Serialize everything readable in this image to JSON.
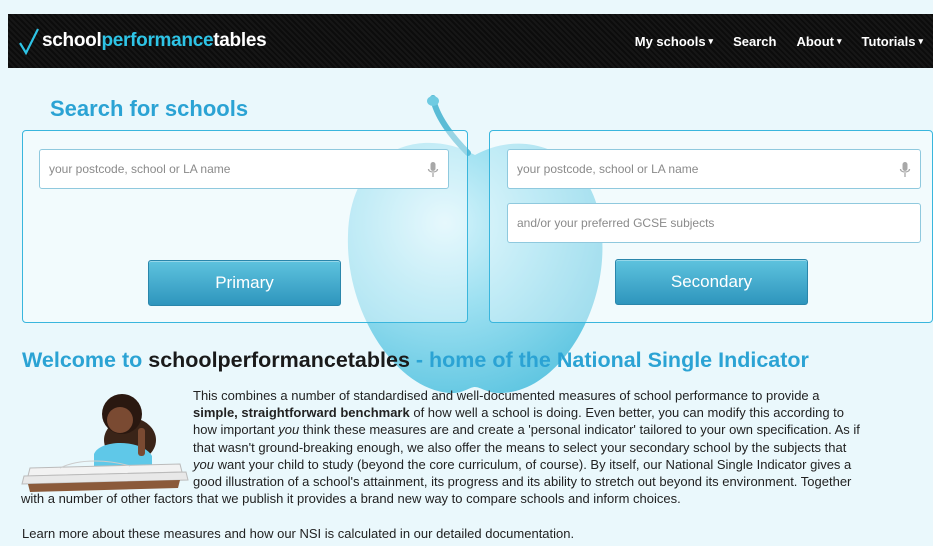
{
  "header": {
    "logo": {
      "prefix": "school",
      "middle": "performance",
      "suffix": "tables"
    },
    "nav": [
      {
        "label": "My schools",
        "dropdown": "▾"
      },
      {
        "label": "Search"
      },
      {
        "label": "About",
        "dropdown": "▾"
      },
      {
        "label": "Tutorials",
        "dropdown": "▾"
      }
    ]
  },
  "search": {
    "title": "Search for schools",
    "primary": {
      "placeholder": "your postcode, school or LA name",
      "button": "Primary"
    },
    "secondary": {
      "placeholder": "your postcode, school or LA name",
      "subjects_placeholder": "and/or your preferred GCSE subjects",
      "button": "Secondary"
    }
  },
  "welcome": {
    "heading_start": "Welcome to ",
    "heading_brand": "schoolperformancetables",
    "heading_end": " - home of the National Single Indicator",
    "p1_a": "This combines a number of standardised and well-documented measures of school performance to provide a",
    "p2_bold": "simple, straightforward benchmark",
    "p2_rest": " of how well a school is doing. Even better, you can modify this according to",
    "p3_a": "how important ",
    "p3_em": "you",
    "p3_b": " think these measures are and create a 'personal indicator' tailored to your own specification. As if",
    "p4": "that wasn't ground-breaking enough, we also offer the means to select your secondary school by the subjects that",
    "p5_em": "you",
    "p5_b": " want your child to study (beyond the core curriculum, of course). By itself, our National Single Indicator gives a",
    "p6": "good illustration of a school's attainment, its progress and its ability to stretch out beyond its environment. Together",
    "p7": "with a number of other factors that we publish it provides a brand new way to compare schools and inform choices.",
    "learn_more": "Learn more about these measures and how our NSI is calculated in our detailed documentation."
  },
  "icons": [
    "check-logo-icon",
    "microphone-icon",
    "apple-image",
    "child-reading-image"
  ],
  "colors": {
    "accent": "#2ba3d4",
    "logo_highlight": "#2ec4e6",
    "button": "#3aa6cd",
    "topbar": "#111111"
  }
}
